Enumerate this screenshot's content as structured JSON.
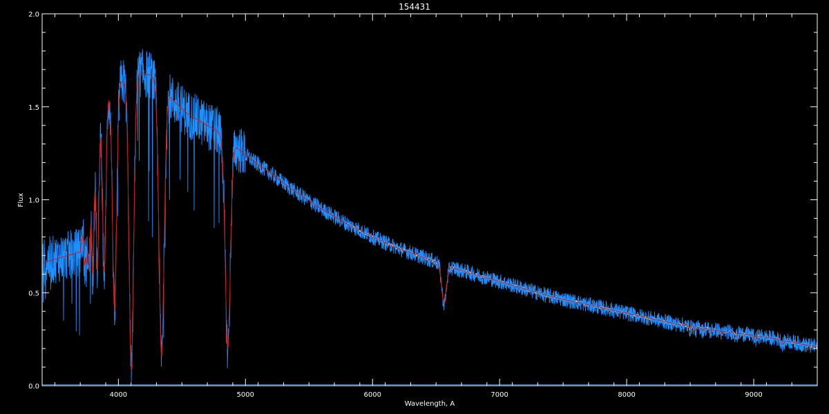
{
  "colors": {
    "background": "#000000",
    "axes": "#ffffff",
    "observed_white": "#ffffff",
    "observed_blue": "#1e90ff",
    "model_red": "#d01818"
  },
  "chart_data": {
    "type": "line",
    "title": "154431",
    "xlabel": "Wavelength, A",
    "ylabel": "Flux",
    "xlim": [
      3400,
      9500
    ],
    "ylim": [
      0,
      2
    ],
    "xticks": [
      "4000",
      "5000",
      "6000",
      "7000",
      "8000",
      "9000"
    ],
    "yticks": [
      "0.0",
      "0.5",
      "1.0",
      "1.5",
      "2.0"
    ],
    "grid": false,
    "legend": "none",
    "continuum": {
      "x": [
        3400,
        3500,
        3600,
        3700,
        3800,
        3850,
        3900,
        3950,
        4000,
        4050,
        4100,
        4150,
        4200,
        4250,
        4300,
        4350,
        4400,
        4450,
        4500,
        4550,
        4600,
        4650,
        4700,
        4750,
        4800,
        4850,
        4900,
        4950,
        5000,
        5200,
        5400,
        5600,
        5800,
        6000,
        6200,
        6400,
        6600,
        6800,
        7000,
        7200,
        7400,
        7600,
        7800,
        8000,
        8200,
        8400,
        8600,
        8800,
        9000,
        9200,
        9400,
        9500
      ],
      "y": [
        0.66,
        0.68,
        0.7,
        0.72,
        1.22,
        1.45,
        1.55,
        1.6,
        1.63,
        1.64,
        1.66,
        1.68,
        1.68,
        1.67,
        1.64,
        1.6,
        1.56,
        1.52,
        1.49,
        1.46,
        1.44,
        1.42,
        1.4,
        1.38,
        1.36,
        1.33,
        1.3,
        1.27,
        1.24,
        1.14,
        1.04,
        0.95,
        0.87,
        0.8,
        0.74,
        0.69,
        0.64,
        0.6,
        0.56,
        0.52,
        0.48,
        0.45,
        0.42,
        0.39,
        0.36,
        0.33,
        0.31,
        0.29,
        0.27,
        0.25,
        0.22,
        0.21
      ]
    },
    "absorption_lines": [
      {
        "x": 3734,
        "depth": 0.25,
        "width": 6
      },
      {
        "x": 3750,
        "depth": 0.3,
        "width": 7
      },
      {
        "x": 3770,
        "depth": 0.4,
        "width": 8
      },
      {
        "x": 3798,
        "depth": 0.5,
        "width": 9
      },
      {
        "x": 3835,
        "depth": 0.55,
        "width": 11
      },
      {
        "x": 3889,
        "depth": 0.6,
        "width": 13
      },
      {
        "x": 3970,
        "depth": 0.75,
        "width": 16
      },
      {
        "x": 4102,
        "depth": 0.95,
        "width": 18
      },
      {
        "x": 4340,
        "depth": 0.9,
        "width": 20
      },
      {
        "x": 4861,
        "depth": 0.85,
        "width": 20
      },
      {
        "x": 6563,
        "depth": 0.32,
        "width": 18
      },
      {
        "x": 8498,
        "depth": 0.05,
        "width": 6
      },
      {
        "x": 8542,
        "depth": 0.06,
        "width": 7
      },
      {
        "x": 8598,
        "depth": 0.05,
        "width": 6
      },
      {
        "x": 8662,
        "depth": 0.06,
        "width": 7
      },
      {
        "x": 8750,
        "depth": 0.06,
        "width": 8
      },
      {
        "x": 8862,
        "depth": 0.07,
        "width": 9
      },
      {
        "x": 9014,
        "depth": 0.08,
        "width": 10
      },
      {
        "x": 9229,
        "depth": 0.09,
        "width": 11
      }
    ],
    "series": [
      {
        "key": "observed_white",
        "noise": 0.012,
        "range": [
          5800,
          9500
        ],
        "color": "#ffffff"
      },
      {
        "key": "observed_blue",
        "noise": 0.06,
        "range": [
          3400,
          9500
        ],
        "color": "#1e90ff"
      },
      {
        "key": "model_red",
        "noise": 0,
        "range": [
          3400,
          9500
        ],
        "color": "#d01818"
      }
    ]
  }
}
